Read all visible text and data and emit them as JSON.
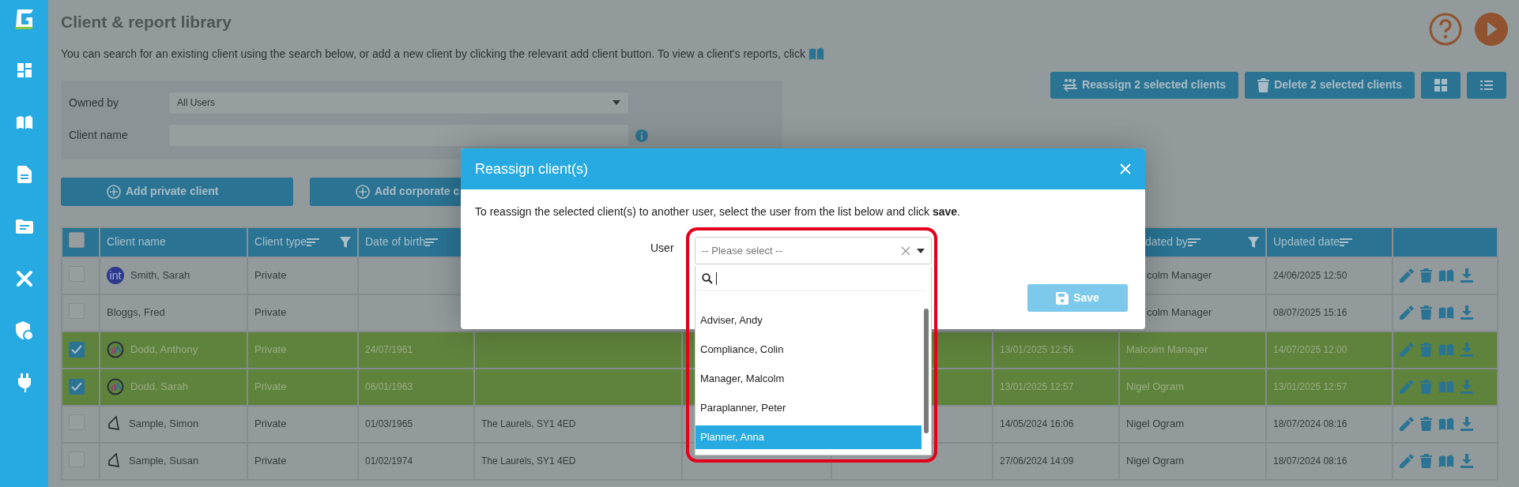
{
  "page": {
    "title": "Client & report library",
    "description": "You can search for an existing client using the search below, or add a new client by clicking the relevant add client button. To view a client's reports, click"
  },
  "filters": [
    {
      "label": "Owned by",
      "kind": "select",
      "value": "All Users"
    },
    {
      "label": "Client name",
      "kind": "text"
    }
  ],
  "actions": [
    "Reassign 2 selected clients",
    "Delete 2 selected clients"
  ],
  "view_buttons": [
    {
      "kind": "grid",
      "selected": false
    },
    {
      "kind": "list",
      "selected": false
    }
  ],
  "add_buttons": [
    "Add private client",
    "Add corporate c"
  ],
  "table": {
    "select_all": {
      "checked": false
    },
    "columns": [
      {
        "label": "Client name",
        "sortable": false,
        "filter": false,
        "cut": false
      },
      {
        "label": "Client type",
        "sortable": true,
        "filter": true,
        "cut": false
      },
      {
        "label": "Date of birth",
        "sortable": true,
        "filter": false,
        "cut": false
      },
      {},
      {},
      {},
      {},
      {
        "label": "dated by",
        "sortable": true,
        "filter": true,
        "cut": true
      },
      {
        "label": "Updated date",
        "sortable": true,
        "filter": false,
        "cut": false
      }
    ],
    "rows": [
      {
        "selected": false,
        "avatar": {
          "kind": "initials",
          "text": "int"
        },
        "name": "Smith, Sarah",
        "type": "Private",
        "updated_by": "colm Manager",
        "updated_by_cut": true,
        "updated_date": "24/06/2025 12:50"
      },
      {
        "selected": false,
        "name": "Bloggs, Fred",
        "type": "Private",
        "updated_by": "colm Manager",
        "updated_by_cut": true,
        "updated_date": "08/07/2025 15:16"
      },
      {
        "selected": true,
        "avatar": {
          "kind": "chart"
        },
        "name": "Dodd, Anthony",
        "type": "Private",
        "dob": "24/07/1961",
        "created": "13/01/2025 12:56",
        "updated_by": "Malcolm Manager",
        "updated_by_cut": false,
        "updated_date": "14/07/2025 12:00"
      },
      {
        "selected": true,
        "avatar": {
          "kind": "chart"
        },
        "name": "Dodd, Sarah",
        "type": "Private",
        "dob": "06/01/1963",
        "created": "13/01/2025 12:57",
        "updated_by": "Nigel Ogram",
        "updated_by_cut": false,
        "updated_date": "13/01/2025 12:57"
      },
      {
        "selected": false,
        "avatar": {
          "kind": "shape"
        },
        "name": "Sample, Simon",
        "type": "Private",
        "dob": "01/03/1965",
        "address": "The Laurels, SY1 4ED",
        "created": "14/05/2024 16:06",
        "updated_by": "Nigel Ogram",
        "updated_by_cut": false,
        "updated_date": "18/07/2024 08:16"
      },
      {
        "selected": false,
        "avatar": {
          "kind": "shape"
        },
        "name": "Sample, Susan",
        "type": "Private",
        "dob": "01/02/1974",
        "address": "The Laurels, SY1 4ED",
        "created": "27/06/2024 14:09",
        "updated_by": "Nigel Ogram",
        "updated_by_cut": false,
        "updated_date": "18/07/2024 08:16"
      }
    ]
  },
  "modal": {
    "title": "Reassign client(s)",
    "text": "To reassign the selected client(s) to another user, select the user from the list below and click **save**.",
    "field_label": "User",
    "placeholder": "-- Please select --",
    "options": [
      {
        "label": "Adviser, Andy",
        "selected": false
      },
      {
        "label": "Compliance, Colin",
        "selected": false
      },
      {
        "label": "Manager, Malcolm",
        "selected": false
      },
      {
        "label": "Paraplanner, Peter",
        "selected": false
      },
      {
        "label": "Planner, Anna",
        "selected": true
      }
    ],
    "save": {
      "label": "Save",
      "disabled": true
    }
  }
}
